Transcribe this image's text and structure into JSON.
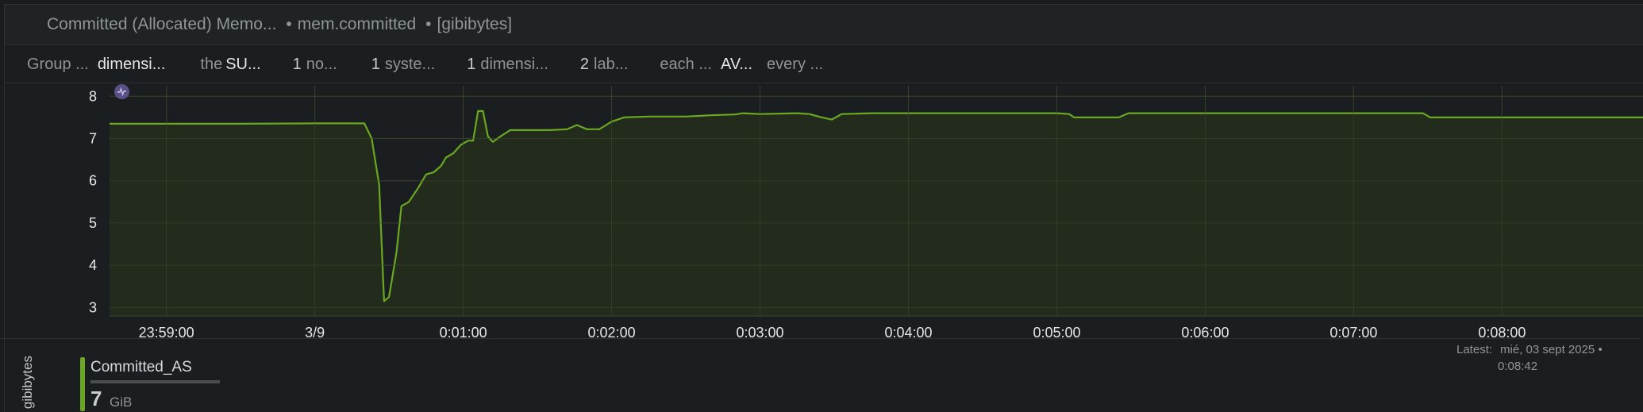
{
  "panel": {
    "title": "Committed (Allocated) Memo...",
    "context": "mem.committed",
    "units": "[gibibytes]",
    "separator": "•"
  },
  "filters": [
    {
      "key": "Group ...",
      "value": "dimensi..."
    },
    {
      "key": "the",
      "value": "SU..."
    },
    {
      "num": "1",
      "value": "no..."
    },
    {
      "num": "1",
      "value": "syste..."
    },
    {
      "num": "1",
      "value": "dimensi..."
    },
    {
      "num": "2",
      "value": "lab..."
    },
    {
      "key": "each ...",
      "value": "AV..."
    },
    {
      "key": "every ...",
      "value": ""
    }
  ],
  "chart_data": {
    "type": "area",
    "ylabel": "gibibytes",
    "ylim": [
      2.8,
      8.25
    ],
    "yticks": [
      3,
      4,
      5,
      6,
      7,
      8
    ],
    "xlim": [
      "23:58:37",
      "00:08:57"
    ],
    "xticks": [
      {
        "t": "23:59:00",
        "label": "23:59:00"
      },
      {
        "t": "00:00:00",
        "label": "3/9"
      },
      {
        "t": "00:01:00",
        "label": "0:01:00"
      },
      {
        "t": "00:02:00",
        "label": "0:02:00"
      },
      {
        "t": "00:03:00",
        "label": "0:03:00"
      },
      {
        "t": "00:04:00",
        "label": "0:04:00"
      },
      {
        "t": "00:05:00",
        "label": "0:05:00"
      },
      {
        "t": "00:06:00",
        "label": "0:06:00"
      },
      {
        "t": "00:07:00",
        "label": "0:07:00"
      },
      {
        "t": "00:08:00",
        "label": "0:08:00"
      }
    ],
    "color": "#6aa823",
    "fill": "#252e1c",
    "series": [
      {
        "name": "Committed_AS",
        "points": [
          [
            "23:58:37",
            7.35
          ],
          [
            "23:59:30",
            7.35
          ],
          [
            "00:00:00",
            7.36
          ],
          [
            "00:00:20",
            7.36
          ],
          [
            "00:00:23",
            7.0
          ],
          [
            "00:00:26",
            5.9
          ],
          [
            "00:00:28",
            3.15
          ],
          [
            "00:00:30",
            3.25
          ],
          [
            "00:00:33",
            4.3
          ],
          [
            "00:00:35",
            5.4
          ],
          [
            "00:00:38",
            5.5
          ],
          [
            "00:00:42",
            5.85
          ],
          [
            "00:00:45",
            6.15
          ],
          [
            "00:00:48",
            6.2
          ],
          [
            "00:00:51",
            6.35
          ],
          [
            "00:00:53",
            6.55
          ],
          [
            "00:00:56",
            6.65
          ],
          [
            "00:00:59",
            6.85
          ],
          [
            "00:01:02",
            6.95
          ],
          [
            "00:01:04",
            6.95
          ],
          [
            "00:01:06",
            7.65
          ],
          [
            "00:01:08",
            7.65
          ],
          [
            "00:01:10",
            7.05
          ],
          [
            "00:01:12",
            6.92
          ],
          [
            "00:01:15",
            7.05
          ],
          [
            "00:01:19",
            7.2
          ],
          [
            "00:01:27",
            7.2
          ],
          [
            "00:01:35",
            7.2
          ],
          [
            "00:01:42",
            7.22
          ],
          [
            "00:01:46",
            7.32
          ],
          [
            "00:01:50",
            7.22
          ],
          [
            "00:01:55",
            7.22
          ],
          [
            "00:02:00",
            7.4
          ],
          [
            "00:02:05",
            7.5
          ],
          [
            "00:02:15",
            7.52
          ],
          [
            "00:02:30",
            7.52
          ],
          [
            "00:02:40",
            7.55
          ],
          [
            "00:02:50",
            7.57
          ],
          [
            "00:02:53",
            7.6
          ],
          [
            "00:03:00",
            7.58
          ],
          [
            "00:03:15",
            7.6
          ],
          [
            "00:03:20",
            7.58
          ],
          [
            "00:03:25",
            7.5
          ],
          [
            "00:03:29",
            7.45
          ],
          [
            "00:03:33",
            7.58
          ],
          [
            "00:03:45",
            7.6
          ],
          [
            "00:04:00",
            7.6
          ],
          [
            "00:04:30",
            7.6
          ],
          [
            "00:05:00",
            7.6
          ],
          [
            "00:05:05",
            7.58
          ],
          [
            "00:05:07",
            7.5
          ],
          [
            "00:05:15",
            7.5
          ],
          [
            "00:05:25",
            7.5
          ],
          [
            "00:05:29",
            7.6
          ],
          [
            "00:06:00",
            7.6
          ],
          [
            "00:06:30",
            7.6
          ],
          [
            "00:07:00",
            7.6
          ],
          [
            "00:07:28",
            7.6
          ],
          [
            "00:07:31",
            7.5
          ],
          [
            "00:08:00",
            7.5
          ],
          [
            "00:08:57",
            7.5
          ]
        ]
      }
    ]
  },
  "legend": {
    "name": "Committed_AS",
    "value": "7",
    "unit": "GiB"
  },
  "latest": {
    "label": "Latest:",
    "date": "mié, 03 sept 2025 •",
    "time": "0:08:42"
  }
}
